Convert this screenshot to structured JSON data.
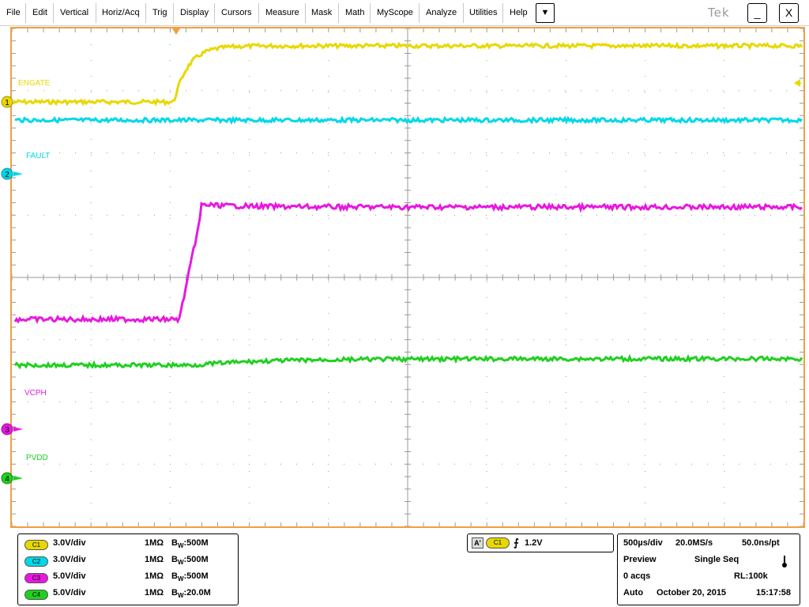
{
  "menu": {
    "items": [
      "File",
      "Edit",
      "Vertical",
      "Horiz/Acq",
      "Trig",
      "Display",
      "Cursors",
      "Measure",
      "Mask",
      "Math",
      "MyScope",
      "Analyze",
      "Utilities",
      "Help"
    ],
    "dropdown_glyph": "▼",
    "logo": "Tek",
    "minimize_glyph": "_",
    "close_glyph": "X"
  },
  "channels": [
    {
      "marker": "1",
      "label": "ENGATE",
      "color": "#e8d800",
      "scale": "3.0V/div",
      "pill": "C1",
      "impedance": "1MΩ",
      "bw_prefix": "B",
      "bw_sub": "W",
      "bw_value": ":500M"
    },
    {
      "marker": "2",
      "label": "FAULT",
      "color": "#00d8e8",
      "scale": "3.0V/div",
      "pill": "C2",
      "impedance": "1MΩ",
      "bw_prefix": "B",
      "bw_sub": "W",
      "bw_value": ":500M"
    },
    {
      "marker": "3",
      "label": "VCPH",
      "color": "#e818e0",
      "scale": "5.0V/div",
      "pill": "C3",
      "impedance": "1MΩ",
      "bw_prefix": "B",
      "bw_sub": "W",
      "bw_value": ":500M"
    },
    {
      "marker": "4",
      "label": "PVDD",
      "color": "#20d020",
      "scale": "5.0V/div",
      "pill": "C4",
      "impedance": "1MΩ",
      "bw_prefix": "B",
      "bw_sub": "W",
      "bw_value": ":20.0M"
    }
  ],
  "trigger": {
    "mode_badge": "A'",
    "source_pill": "C1",
    "slope_glyph": "⨍",
    "level": "1.2V"
  },
  "horizontal": {
    "time_div": "500µs/div",
    "sample_rate": "20.0MS/s",
    "resolution": "50.0ns/pt",
    "status": "Preview",
    "acq_mode": "Single Seq",
    "acqs": "0 acqs",
    "record_length": "RL:100k",
    "trigger_mode": "Auto",
    "date": "October 20, 2015",
    "time": "15:17:58"
  },
  "colors": {
    "graticule_border": "#f0a040",
    "grid": "#9a9a9a",
    "trigger_marker": "#f0a040"
  }
}
